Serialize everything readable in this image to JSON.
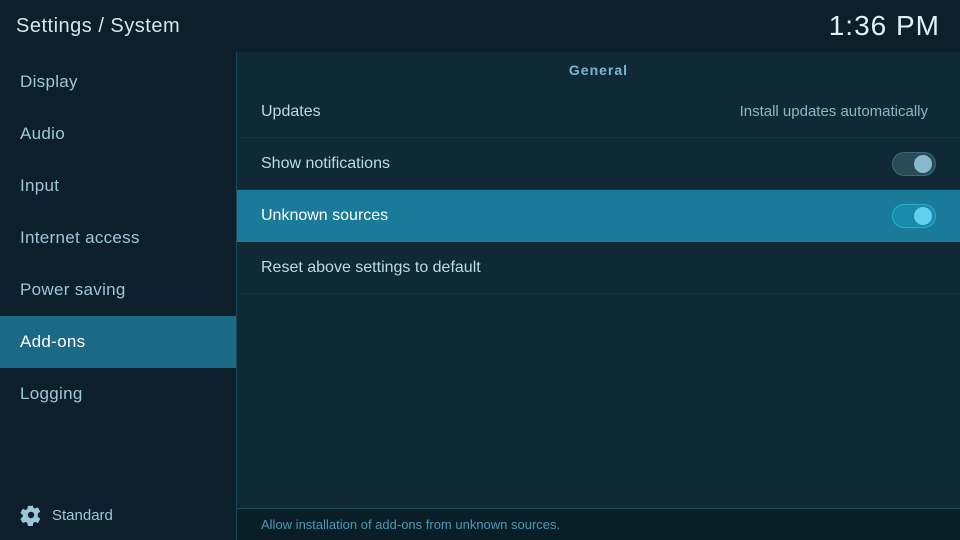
{
  "header": {
    "title": "Settings / System",
    "time": "1:36 PM"
  },
  "sidebar": {
    "items": [
      {
        "id": "display",
        "label": "Display",
        "active": false
      },
      {
        "id": "audio",
        "label": "Audio",
        "active": false
      },
      {
        "id": "input",
        "label": "Input",
        "active": false
      },
      {
        "id": "internet-access",
        "label": "Internet access",
        "active": false
      },
      {
        "id": "power-saving",
        "label": "Power saving",
        "active": false
      },
      {
        "id": "add-ons",
        "label": "Add-ons",
        "active": true
      },
      {
        "id": "logging",
        "label": "Logging",
        "active": false
      }
    ],
    "footer_label": "Standard",
    "footer_icon": "gear"
  },
  "content": {
    "section_header": "General",
    "settings": [
      {
        "id": "updates",
        "label": "Updates",
        "value_text": "Install updates automatically",
        "has_toggle": false,
        "toggle_state": null,
        "highlighted": false
      },
      {
        "id": "show-notifications",
        "label": "Show notifications",
        "value_text": null,
        "has_toggle": true,
        "toggle_state": "off",
        "highlighted": false
      },
      {
        "id": "unknown-sources",
        "label": "Unknown sources",
        "value_text": null,
        "has_toggle": true,
        "toggle_state": "on",
        "highlighted": true
      },
      {
        "id": "reset-settings",
        "label": "Reset above settings to default",
        "value_text": null,
        "has_toggle": false,
        "toggle_state": null,
        "highlighted": false
      }
    ],
    "status_text": "Allow installation of add-ons from unknown sources."
  }
}
